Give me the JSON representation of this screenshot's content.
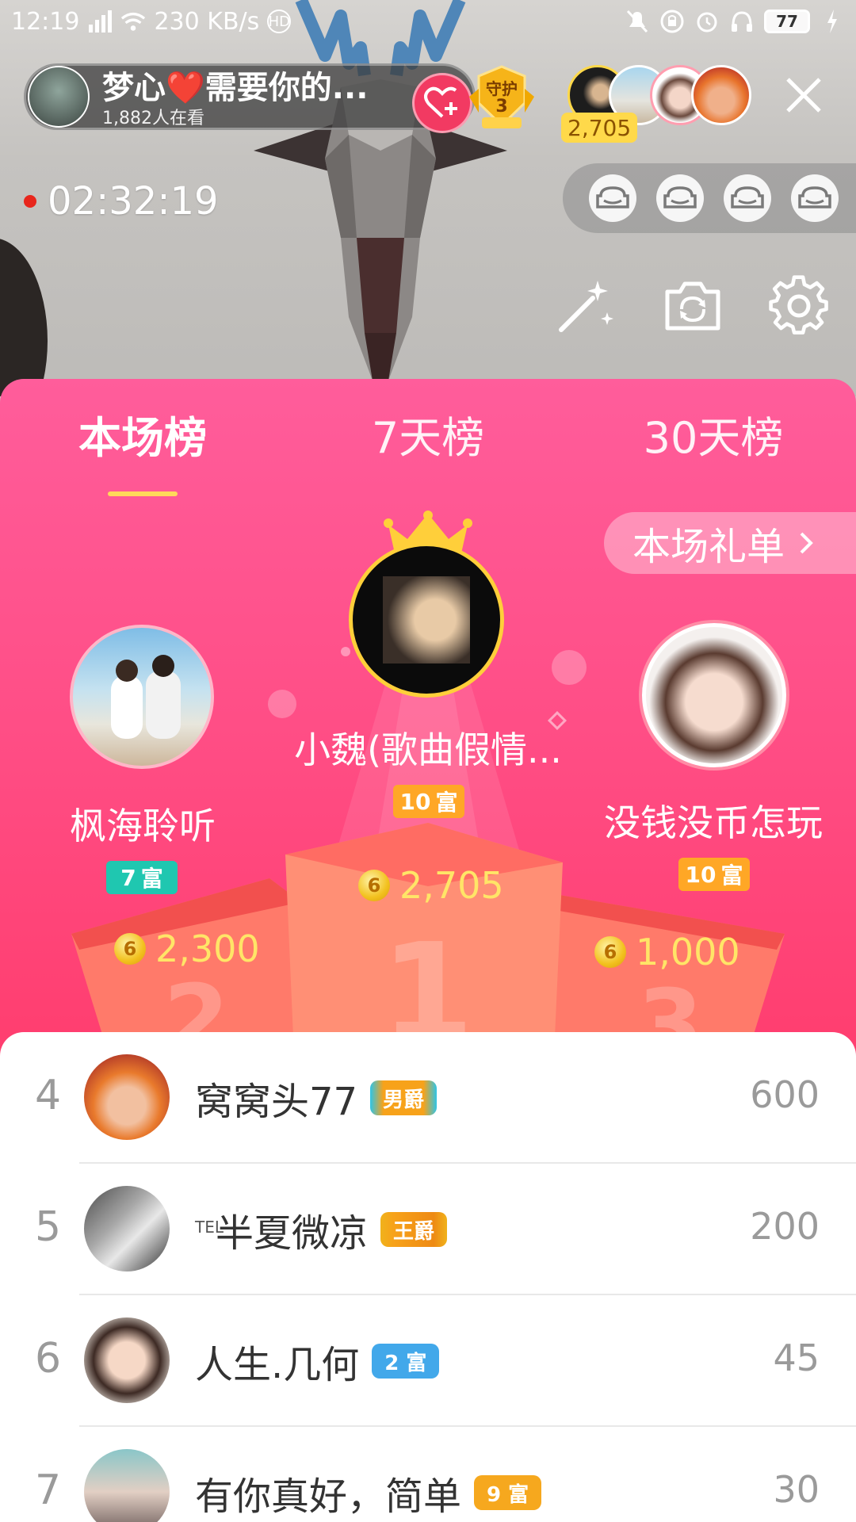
{
  "status_bar": {
    "time": "12:19",
    "network": "4G",
    "speed": "230 KB/s",
    "hd": "HD",
    "battery": "77"
  },
  "anchor": {
    "name": "梦心❤️需要你的...",
    "viewers": "1,882人在看",
    "guard_label": "守护",
    "guard_count": "3"
  },
  "audience": {
    "count": "2,705"
  },
  "timer": "02:32:19",
  "tabs": [
    "本场榜",
    "7天榜",
    "30天榜"
  ],
  "gift_list_label": "本场礼单",
  "top3": [
    {
      "rank": 1,
      "name": "小魏(歌曲假情...",
      "level": "10",
      "level_label": "富",
      "score": "2,705",
      "badge_color": "#ffa726"
    },
    {
      "rank": 2,
      "name": "枫海聆听",
      "level": "7",
      "level_label": "富",
      "score": "2,300",
      "badge_color": "#1fc7b0"
    },
    {
      "rank": 3,
      "name": "没钱没币怎玩",
      "level": "10",
      "level_label": "富",
      "score": "1,000",
      "badge_color": "#ffa726"
    }
  ],
  "coin_symbol": "6",
  "podium_numbers": [
    "1",
    "2",
    "3"
  ],
  "list": [
    {
      "rank": "4",
      "name": "窝窝头77",
      "badge": "男爵",
      "badge_type": "noble",
      "score": "600",
      "tel": ""
    },
    {
      "rank": "5",
      "name": "半夏微凉",
      "badge": "王爵",
      "badge_type": "noble",
      "score": "200",
      "tel": "TEL"
    },
    {
      "rank": "6",
      "name": "人生.几何",
      "badge": "2 富",
      "badge_type": "rich-blue",
      "score": "45",
      "tel": ""
    },
    {
      "rank": "7",
      "name": "有你真好，简单",
      "badge": "9 富",
      "badge_type": "rich-orange",
      "score": "30",
      "tel": ""
    }
  ],
  "colors": {
    "panel_top": "#ff5d9b",
    "panel_bottom": "#fa3c5c",
    "gold": "#ffe567",
    "follow": "#f23a62"
  }
}
